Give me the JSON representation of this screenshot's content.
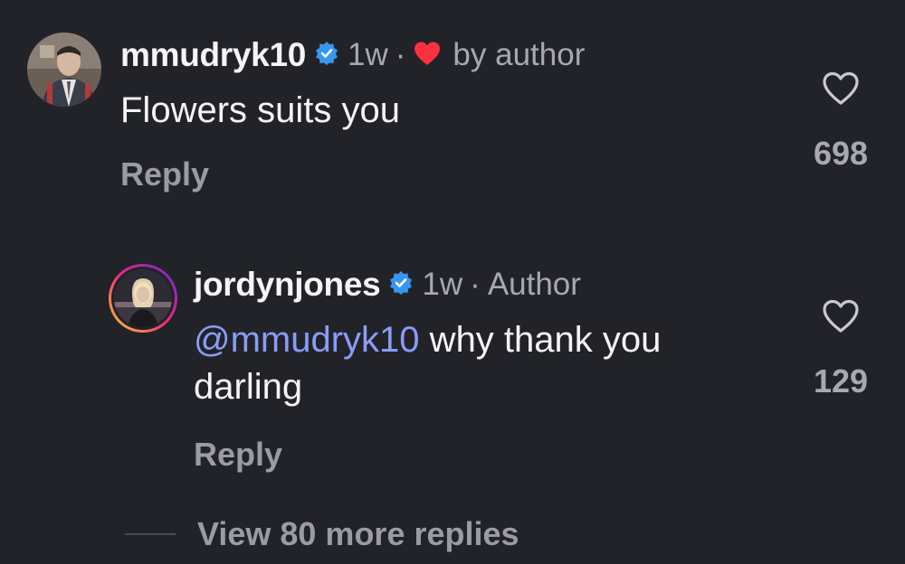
{
  "comment": {
    "username": "mmudryk10",
    "time": "1w",
    "separator": "·",
    "liked_by_author_label": "by author",
    "text": "Flowers suits you",
    "reply_label": "Reply",
    "like_count": "698"
  },
  "reply": {
    "username": "jordynjones",
    "time": "1w",
    "separator": "·",
    "author_label": "Author",
    "mention": "@mmudryk10",
    "text": " why thank you darling",
    "reply_label": "Reply",
    "like_count": "129"
  },
  "view_more_label": "View 80 more replies",
  "colors": {
    "background": "#222328",
    "verified": "#3797f0",
    "heart": "#ff3040",
    "mention": "#8b9cf7",
    "story_ring_start": "#f9ce34",
    "story_ring_mid": "#ee2a7b",
    "story_ring_end": "#6228d7"
  },
  "icons": {
    "verified": "verified-badge-icon",
    "author_heart": "heart-filled-icon",
    "like": "heart-outline-icon"
  }
}
